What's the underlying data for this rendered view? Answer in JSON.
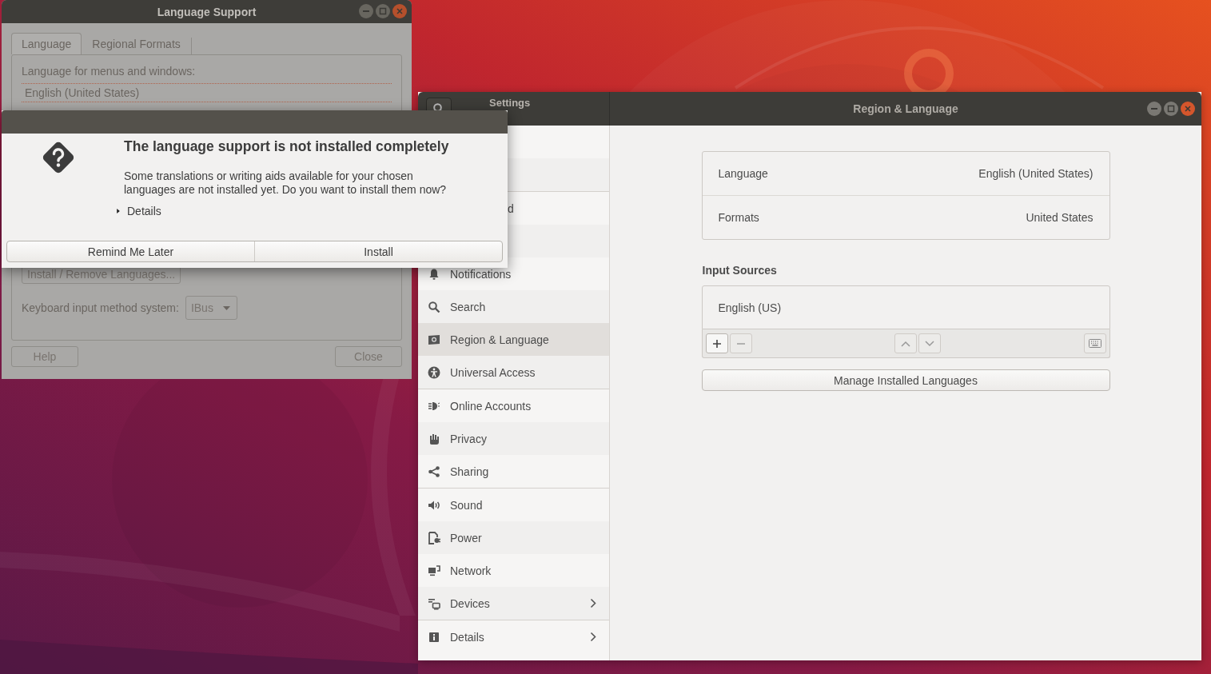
{
  "language_support": {
    "title": "Language Support",
    "tabs": [
      {
        "label": "Language",
        "selected": true
      },
      {
        "label": "Regional Formats",
        "selected": false
      }
    ],
    "list_label": "Language for menus and windows:",
    "languages": [
      "English (United States)"
    ],
    "install_button": "Install / Remove Languages...",
    "input_method_label": "Keyboard input method system:",
    "input_method": "IBus",
    "help_button": "Help",
    "close_button": "Close"
  },
  "dialog": {
    "title": "The language support is not installed completely",
    "message": [
      "Some translations or writing aids available for your chosen",
      "languages are not installed yet. Do you want to install them now?"
    ],
    "details": {
      "label": "Details",
      "expanded": false
    },
    "buttons": [
      "Remind Me Later",
      "Install"
    ]
  },
  "settings": {
    "title": "Settings",
    "panel_title": "Region & Language",
    "sidebar": {
      "groups": [
        {
          "items": [
            {
              "kind": "covered",
              "selected": false
            },
            {
              "kind": "covered",
              "selected": false
            }
          ]
        },
        {
          "items": [
            {
              "kind": "clipped",
              "label": "d",
              "selected": false,
              "submenu": false
            },
            {
              "kind": "covered",
              "selected": false
            },
            {
              "kind": "item",
              "label": "Notifications",
              "selected": false,
              "submenu": false
            },
            {
              "kind": "item",
              "label": "Search",
              "selected": false,
              "submenu": false
            },
            {
              "kind": "item",
              "label": "Region & Language",
              "selected": true,
              "submenu": false
            },
            {
              "kind": "item",
              "label": "Universal Access",
              "selected": false,
              "submenu": false
            }
          ]
        },
        {
          "items": [
            {
              "kind": "item",
              "label": "Online Accounts",
              "selected": false,
              "submenu": false
            },
            {
              "kind": "item",
              "label": "Privacy",
              "selected": false,
              "submenu": false
            },
            {
              "kind": "item",
              "label": "Sharing",
              "selected": false,
              "submenu": false
            }
          ]
        },
        {
          "items": [
            {
              "kind": "item",
              "label": "Sound",
              "selected": false,
              "submenu": false
            },
            {
              "kind": "item",
              "label": "Power",
              "selected": false,
              "submenu": false
            },
            {
              "kind": "item",
              "label": "Network",
              "selected": false,
              "submenu": false
            },
            {
              "kind": "item",
              "label": "Devices",
              "selected": false,
              "submenu": true
            }
          ]
        },
        {
          "items": [
            {
              "kind": "item",
              "label": "Details",
              "selected": false,
              "submenu": true
            }
          ]
        }
      ]
    },
    "rows": [
      {
        "label": "Language",
        "value": "English (United States)"
      },
      {
        "label": "Formats",
        "value": "United States"
      }
    ],
    "input_sources": {
      "title": "Input Sources",
      "items": [
        "English (US)"
      ]
    },
    "manage_button": "Manage Installed Languages"
  }
}
